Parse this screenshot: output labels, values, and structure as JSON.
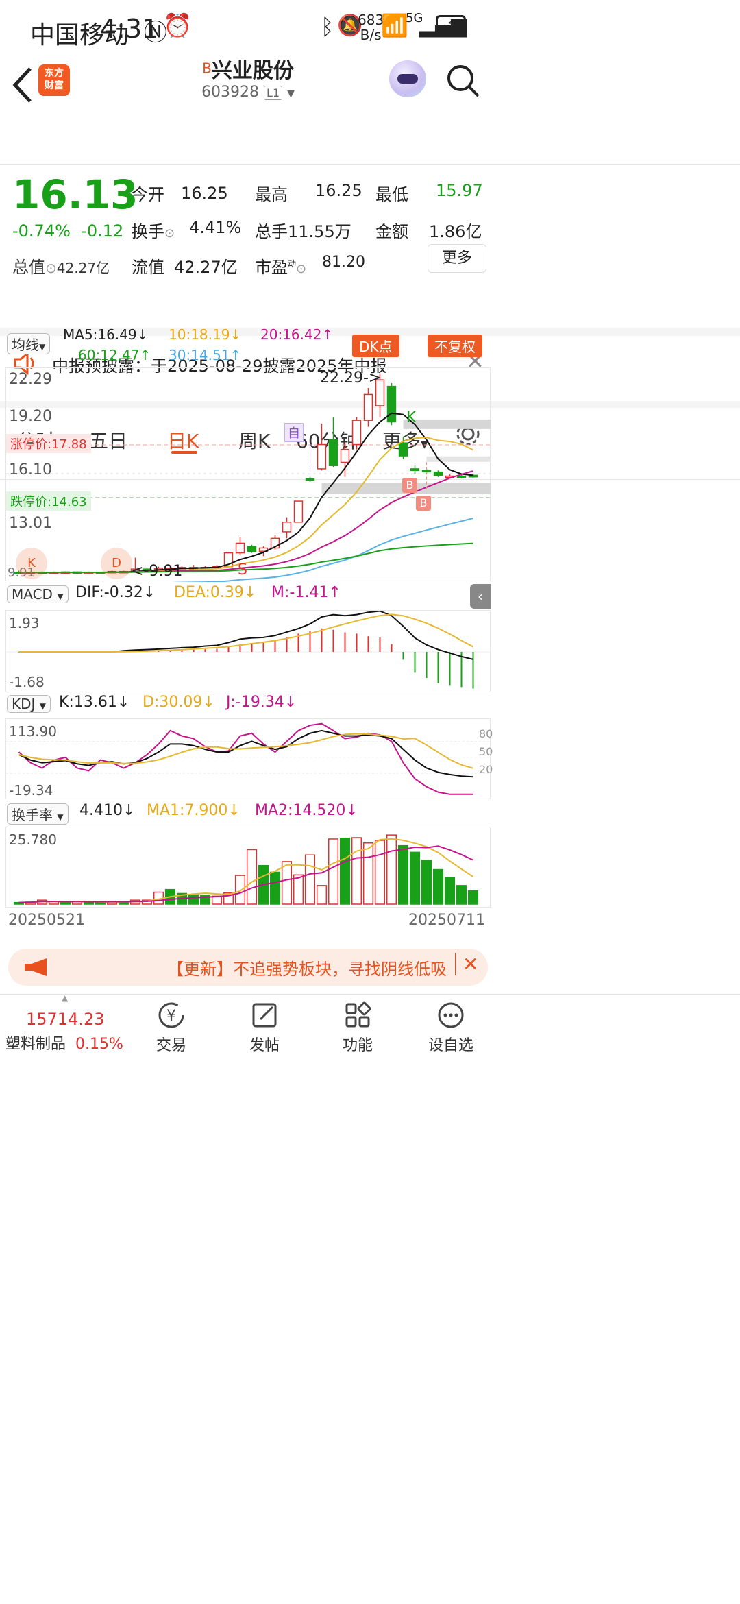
{
  "status_bar": {
    "carrier": "中国移动",
    "time": "4:31",
    "net_speed_top": "683",
    "net_speed_bottom": "B/s",
    "signal": "5G"
  },
  "header": {
    "badge_line1": "东方",
    "badge_line2": "财富",
    "title_prefix": "B",
    "title": "兴业股份",
    "code": "603928",
    "level": "L1"
  },
  "quote": {
    "price": "16.13",
    "change_pct": "-0.74%",
    "change": "-0.12",
    "open_label": "今开",
    "open": "16.25",
    "high_label": "最高",
    "high": "16.25",
    "low_label": "最低",
    "low": "15.97",
    "turnover_label": "换手",
    "turnover": "4.41%",
    "volume_label": "总手",
    "volume": "11.55万",
    "amount_label": "金额",
    "amount": "1.86亿",
    "mktcap_label": "总值",
    "mktcap": "42.27亿",
    "float_label": "流值",
    "float": "42.27亿",
    "pe_label": "市盈",
    "pe_sup": "动",
    "pe": "81.20",
    "more": "更多"
  },
  "notice": {
    "text": "中报预披露：于2025-08-29披露2025年中报"
  },
  "tabs": [
    "分时",
    "五日",
    "日K",
    "周K",
    "60分钟",
    "更多"
  ],
  "active_tab": "日K",
  "ma_bar": {
    "selector": "均线",
    "ma5": "MA5:16.49↓",
    "ma10": "10:18.19↓",
    "ma20": "20:16.42↑",
    "ma60": "60:12.47↑",
    "ma30": "30:14.51↑",
    "dk": "DK点",
    "fq": "不复权"
  },
  "kline": {
    "y_labels": [
      "22.29",
      "19.20",
      "16.10",
      "13.01"
    ],
    "high_annot": "22.29->",
    "low_annot": "<-9.91",
    "bottom_label": "9.91",
    "limit_up": "涨停价:17.88",
    "limit_down": "跌停价:14.63",
    "zi": "自",
    "k_mark": "K",
    "s_mark": "S",
    "b_mark": "B",
    "d_mark": "D",
    "kk_mark": "K"
  },
  "macd": {
    "selector": "MACD",
    "dif": "DIF:-0.32↓",
    "dea": "DEA:0.39↓",
    "m": "M:-1.41↑",
    "ymax": "1.93",
    "ymin": "-1.68"
  },
  "kdj": {
    "selector": "KDJ",
    "k": "K:13.61↓",
    "d": "D:30.09↓",
    "j": "J:-19.34↓",
    "ymax": "113.90",
    "ymin": "-19.34",
    "r80": "80",
    "r50": "50",
    "r20": "20"
  },
  "turnover_panel": {
    "selector": "换手率",
    "val": "4.410↓",
    "ma1": "MA1:7.900↓",
    "ma2": "MA2:14.520↓",
    "ymax": "25.780"
  },
  "dates": {
    "start": "20250521",
    "end": "20250711"
  },
  "ad": {
    "text": "【更新】不追强势板块，寻找阴线低吸"
  },
  "bottom": {
    "index_value": "15714.23",
    "index_name": "塑料制品",
    "index_change": "0.15%",
    "nav": [
      "交易",
      "发帖",
      "功能",
      "设自选"
    ]
  },
  "chart_data": {
    "type": "candlestick",
    "price_range": [
      9.91,
      22.29
    ],
    "candles": [
      {
        "o": 10.0,
        "c": 9.95,
        "h": 10.1,
        "l": 9.9,
        "up": false
      },
      {
        "o": 9.95,
        "c": 10.0,
        "h": 10.05,
        "l": 9.9,
        "up": true
      },
      {
        "o": 10.0,
        "c": 9.97,
        "h": 10.05,
        "l": 9.93,
        "up": false
      },
      {
        "o": 9.97,
        "c": 10.0,
        "h": 10.05,
        "l": 9.92,
        "up": true
      },
      {
        "o": 10.0,
        "c": 10.02,
        "h": 10.05,
        "l": 9.95,
        "up": true
      },
      {
        "o": 10.02,
        "c": 9.98,
        "h": 10.05,
        "l": 9.93,
        "up": false
      },
      {
        "o": 9.98,
        "c": 10.0,
        "h": 10.05,
        "l": 9.95,
        "up": true
      },
      {
        "o": 10.0,
        "c": 9.97,
        "h": 10.03,
        "l": 9.91,
        "up": false
      },
      {
        "o": 9.97,
        "c": 10.05,
        "h": 10.1,
        "l": 9.95,
        "up": true
      },
      {
        "o": 10.05,
        "c": 10.05,
        "h": 10.1,
        "l": 10.0,
        "up": true
      },
      {
        "o": 10.05,
        "c": 10.2,
        "h": 10.9,
        "l": 10.0,
        "up": true
      },
      {
        "o": 10.2,
        "c": 10.18,
        "h": 10.3,
        "l": 10.1,
        "up": false
      },
      {
        "o": 10.18,
        "c": 10.25,
        "h": 10.35,
        "l": 10.1,
        "up": true
      },
      {
        "o": 10.25,
        "c": 10.25,
        "h": 10.35,
        "l": 10.15,
        "up": true
      },
      {
        "o": 10.25,
        "c": 10.3,
        "h": 10.4,
        "l": 10.2,
        "up": true
      },
      {
        "o": 10.3,
        "c": 10.3,
        "h": 10.45,
        "l": 10.2,
        "up": true
      },
      {
        "o": 10.3,
        "c": 10.3,
        "h": 10.4,
        "l": 10.25,
        "up": true
      },
      {
        "o": 10.3,
        "c": 10.35,
        "h": 10.45,
        "l": 10.25,
        "up": true
      },
      {
        "o": 10.35,
        "c": 11.2,
        "h": 11.25,
        "l": 10.3,
        "up": true
      },
      {
        "o": 11.2,
        "c": 11.8,
        "h": 12.2,
        "l": 11.1,
        "up": true
      },
      {
        "o": 11.6,
        "c": 11.3,
        "h": 11.7,
        "l": 11.2,
        "up": false
      },
      {
        "o": 11.3,
        "c": 11.5,
        "h": 11.6,
        "l": 11.0,
        "up": true
      },
      {
        "o": 11.5,
        "c": 12.1,
        "h": 12.3,
        "l": 11.4,
        "up": true
      },
      {
        "o": 12.5,
        "c": 13.1,
        "h": 13.4,
        "l": 12.1,
        "up": true
      },
      {
        "o": 13.1,
        "c": 14.4,
        "h": 14.4,
        "l": 13.1,
        "up": true
      },
      {
        "o": 15.8,
        "c": 15.7,
        "h": 15.9,
        "l": 15.6,
        "up": false
      },
      {
        "o": 16.4,
        "c": 17.9,
        "h": 19.2,
        "l": 16.3,
        "up": true
      },
      {
        "o": 18.2,
        "c": 16.6,
        "h": 19.6,
        "l": 16.5,
        "up": false
      },
      {
        "o": 16.8,
        "c": 17.6,
        "h": 18.0,
        "l": 15.9,
        "up": true
      },
      {
        "o": 17.9,
        "c": 19.4,
        "h": 19.6,
        "l": 17.6,
        "up": true
      },
      {
        "o": 19.4,
        "c": 21.0,
        "h": 21.4,
        "l": 19.0,
        "up": true
      },
      {
        "o": 20.3,
        "c": 21.9,
        "h": 22.29,
        "l": 19.6,
        "up": true
      },
      {
        "o": 21.5,
        "c": 19.3,
        "h": 21.7,
        "l": 19.1,
        "up": false
      },
      {
        "o": 18.0,
        "c": 17.2,
        "h": 18.4,
        "l": 17.0,
        "up": false
      },
      {
        "o": 16.4,
        "c": 16.3,
        "h": 16.6,
        "l": 16.1,
        "up": false
      },
      {
        "o": 16.3,
        "c": 16.25,
        "h": 16.4,
        "l": 16.1,
        "up": false
      },
      {
        "o": 16.2,
        "c": 16.0,
        "h": 16.3,
        "l": 15.9,
        "up": false
      },
      {
        "o": 15.9,
        "c": 15.95,
        "h": 16.05,
        "l": 15.85,
        "up": true
      },
      {
        "o": 15.95,
        "c": 15.9,
        "h": 16.05,
        "l": 15.8,
        "up": false
      },
      {
        "o": 16.0,
        "c": 15.9,
        "h": 16.05,
        "l": 15.8,
        "up": false
      }
    ]
  }
}
